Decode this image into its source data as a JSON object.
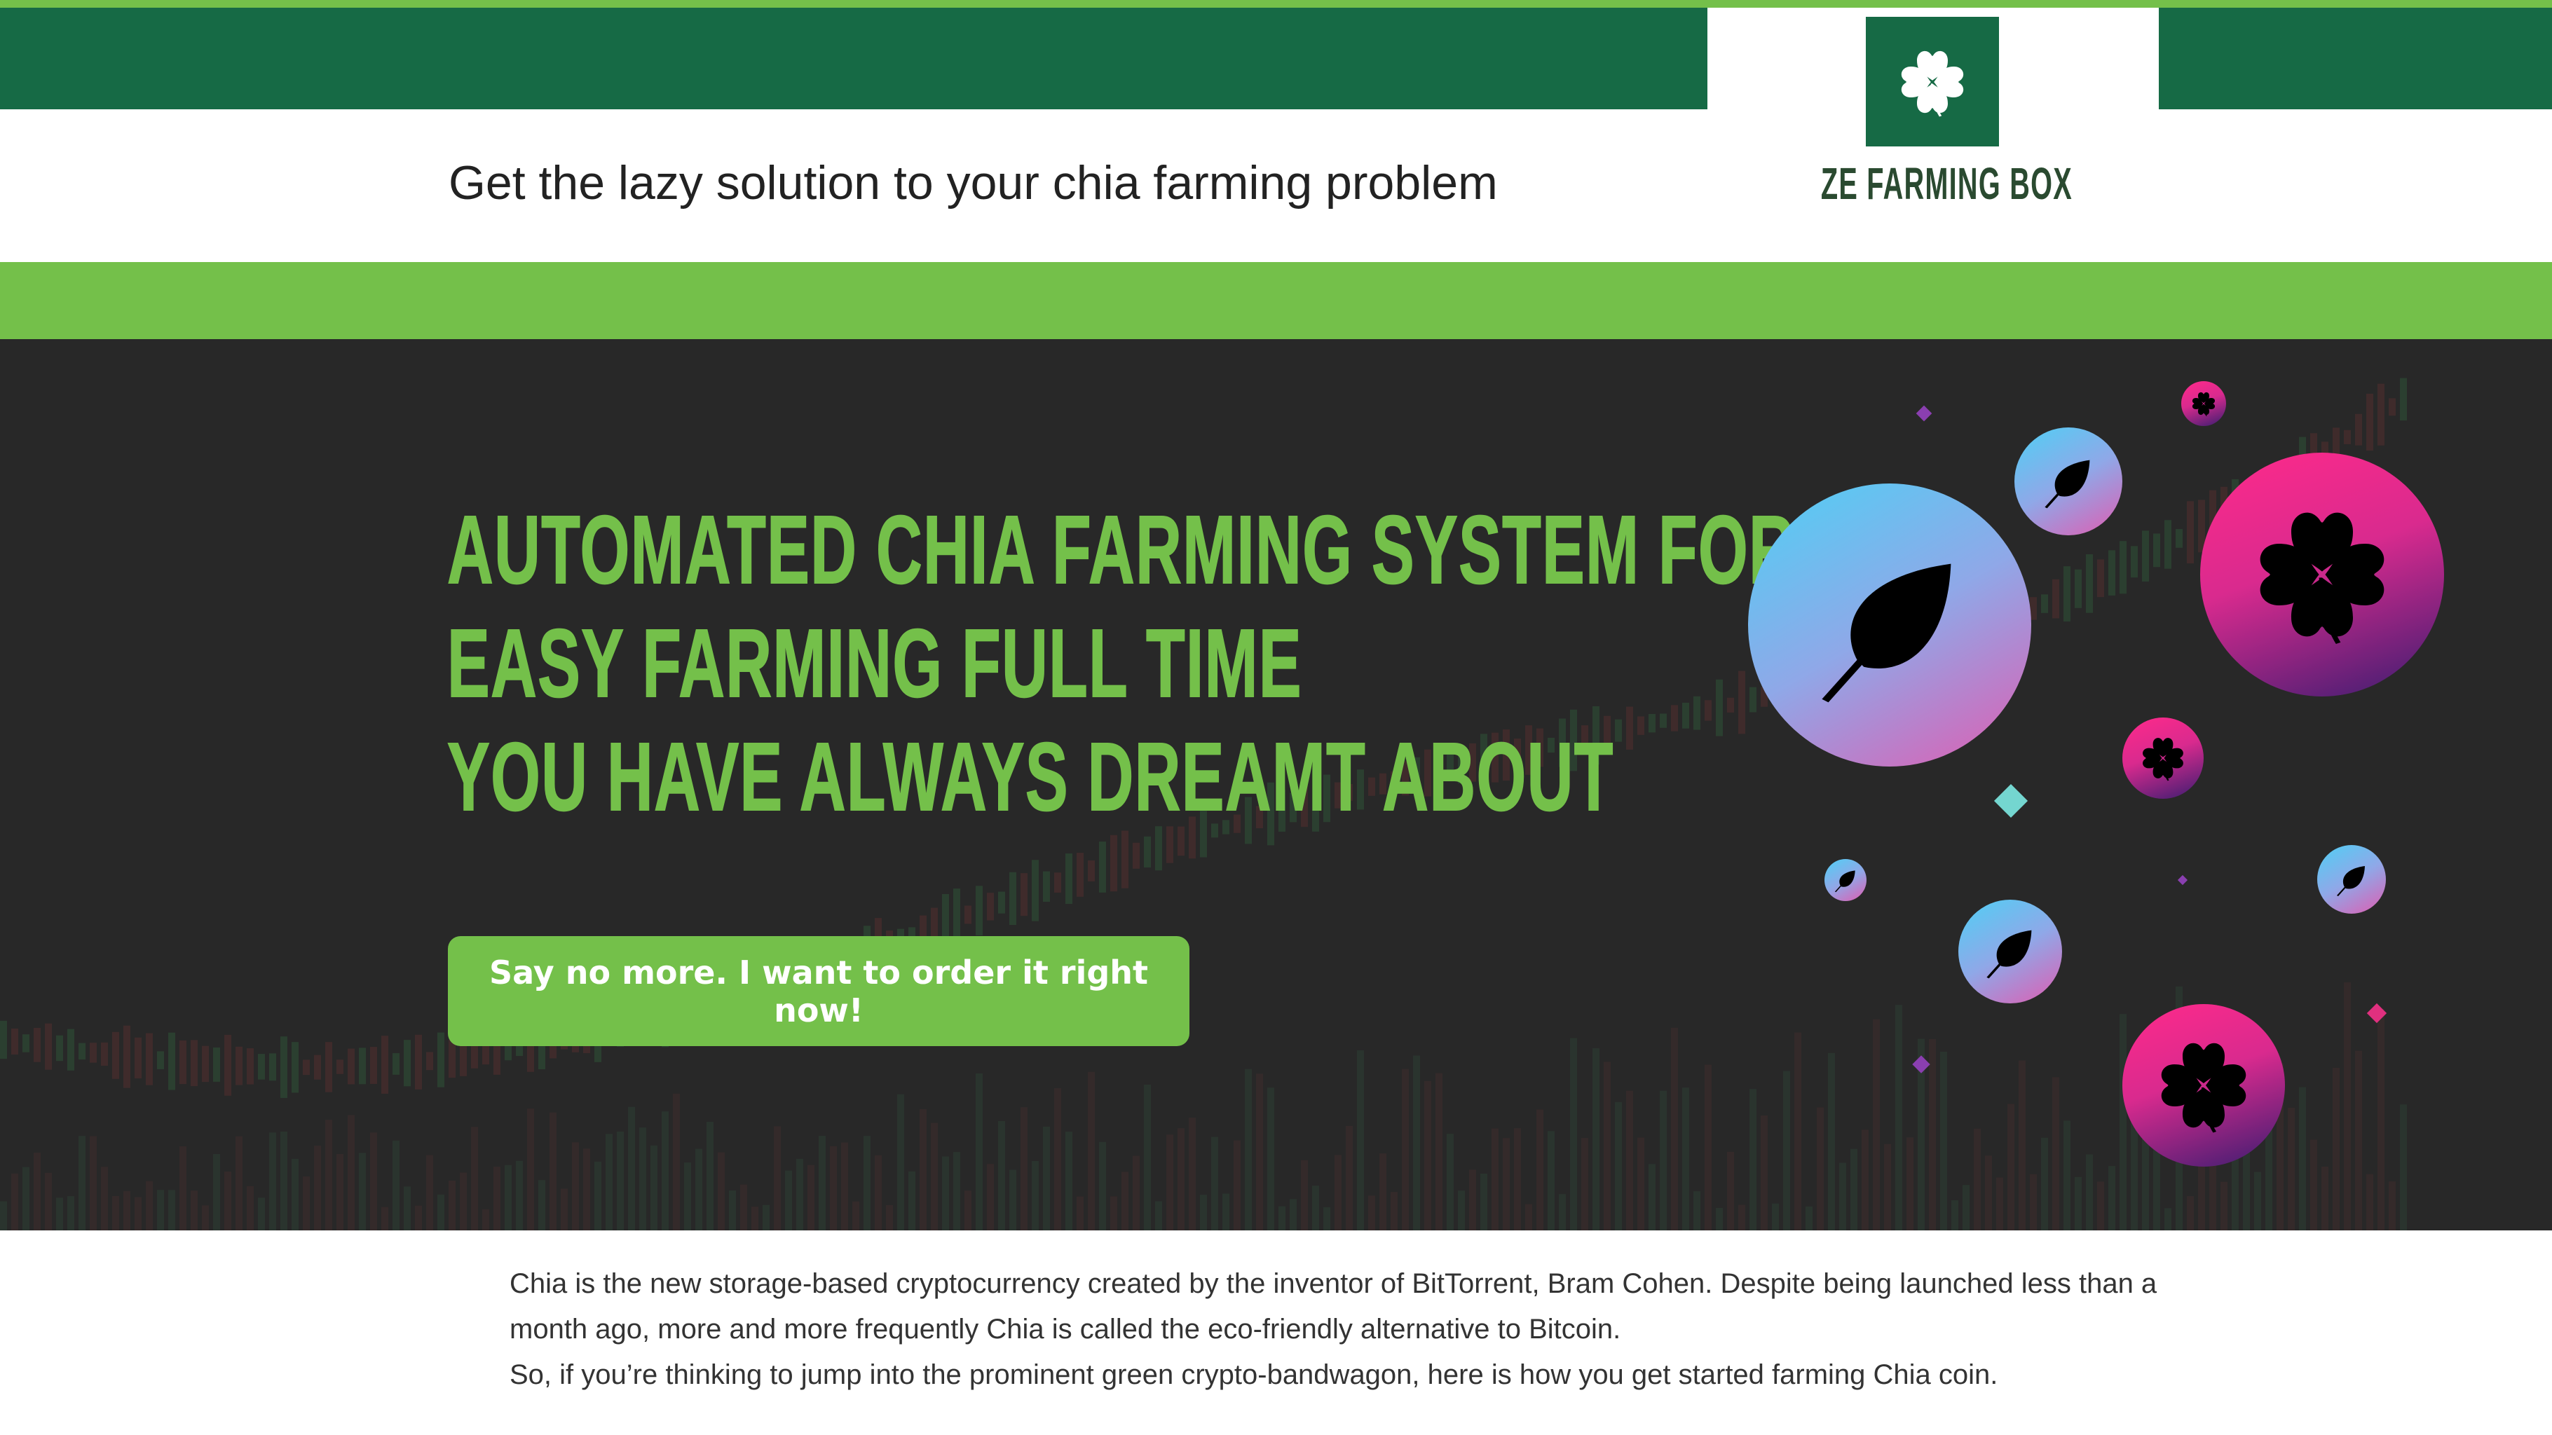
{
  "header": {
    "tagline": "Get the lazy solution to your chia farming problem",
    "logo_text": "ZE FARMING BOX",
    "logo_icon": "clover-icon"
  },
  "hero": {
    "headline": [
      "AUTOMATED CHIA FARMING SYSTEM FOR",
      "EASY FARMING FULL TIME",
      "YOU HAVE ALWAYS DREAMT ABOUT"
    ],
    "cta_label": "Say no more. I want to order it right now!"
  },
  "intro": {
    "paragraph1": "Chia is the new storage-based cryptocurrency created by the inventor of BitTorrent, Bram Cohen. Despite being launched less than a month ago, more and more frequently Chia is called the eco-friendly alternative to Bitcoin.",
    "paragraph2": "So, if you’re thinking to jump into the prominent green crypto-bandwagon, here is how you get started farming Chia coin."
  },
  "colors": {
    "dark_green": "#166a45",
    "light_green": "#74c04a",
    "hero_bg": "#282828",
    "logo_text": "#2a4a30"
  }
}
